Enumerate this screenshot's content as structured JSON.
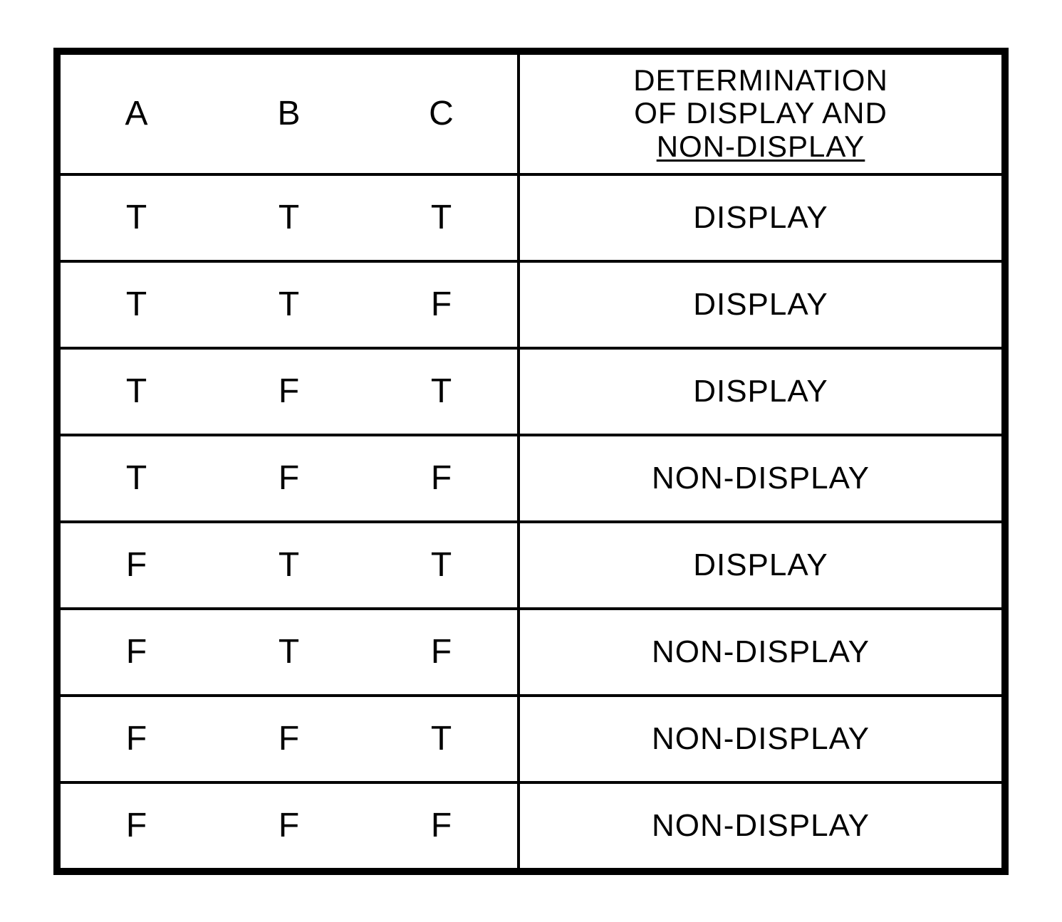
{
  "chart_data": {
    "type": "table",
    "headers": {
      "a": "A",
      "b": "B",
      "c": "C",
      "det_line1": "DETERMINATION",
      "det_line2": "OF DISPLAY AND",
      "det_line3": "NON-DISPLAY"
    },
    "rows": [
      {
        "a": "T",
        "b": "T",
        "c": "T",
        "det": "DISPLAY"
      },
      {
        "a": "T",
        "b": "T",
        "c": "F",
        "det": "DISPLAY"
      },
      {
        "a": "T",
        "b": "F",
        "c": "T",
        "det": "DISPLAY"
      },
      {
        "a": "T",
        "b": "F",
        "c": "F",
        "det": "NON-DISPLAY"
      },
      {
        "a": "F",
        "b": "T",
        "c": "T",
        "det": "DISPLAY"
      },
      {
        "a": "F",
        "b": "T",
        "c": "F",
        "det": "NON-DISPLAY"
      },
      {
        "a": "F",
        "b": "F",
        "c": "T",
        "det": "NON-DISPLAY"
      },
      {
        "a": "F",
        "b": "F",
        "c": "F",
        "det": "NON-DISPLAY"
      }
    ]
  }
}
